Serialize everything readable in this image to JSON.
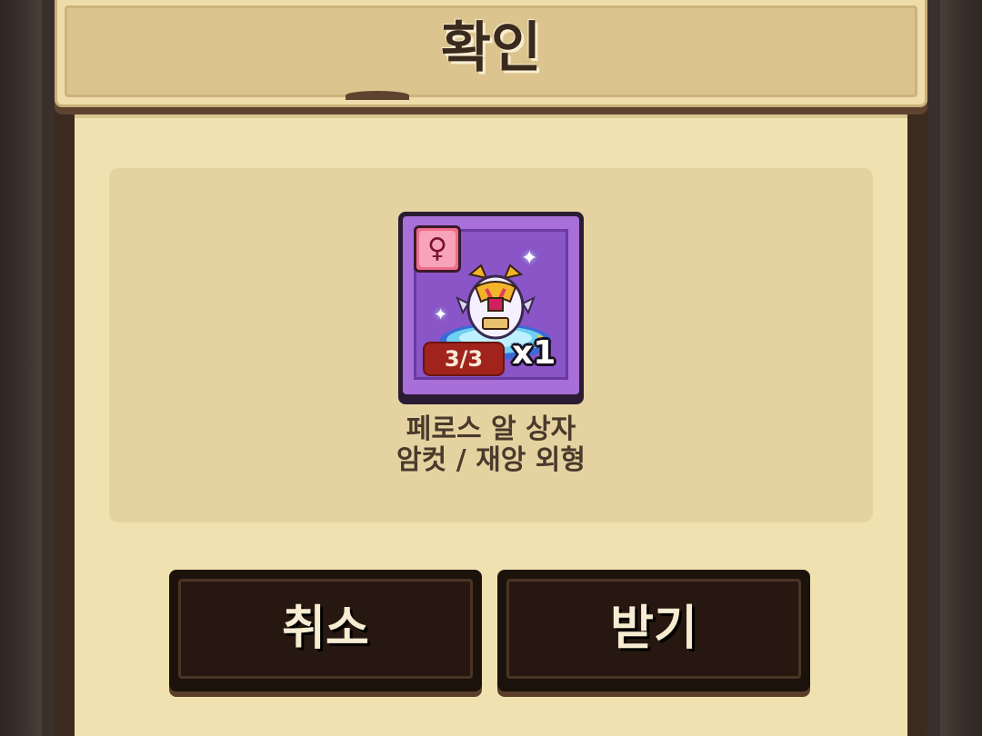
{
  "dialog": {
    "title": "확인"
  },
  "item": {
    "icon": "female-symbol-icon",
    "gender_symbol": "♀",
    "count_badge": "3/3",
    "quantity": "x1",
    "name": "페로스 알 상자",
    "subname": "암컷 / 재앙 외형",
    "card_color": "#a86fd8",
    "badge_color": "#a0241c"
  },
  "buttons": {
    "cancel_label": "취소",
    "accept_label": "받기"
  }
}
